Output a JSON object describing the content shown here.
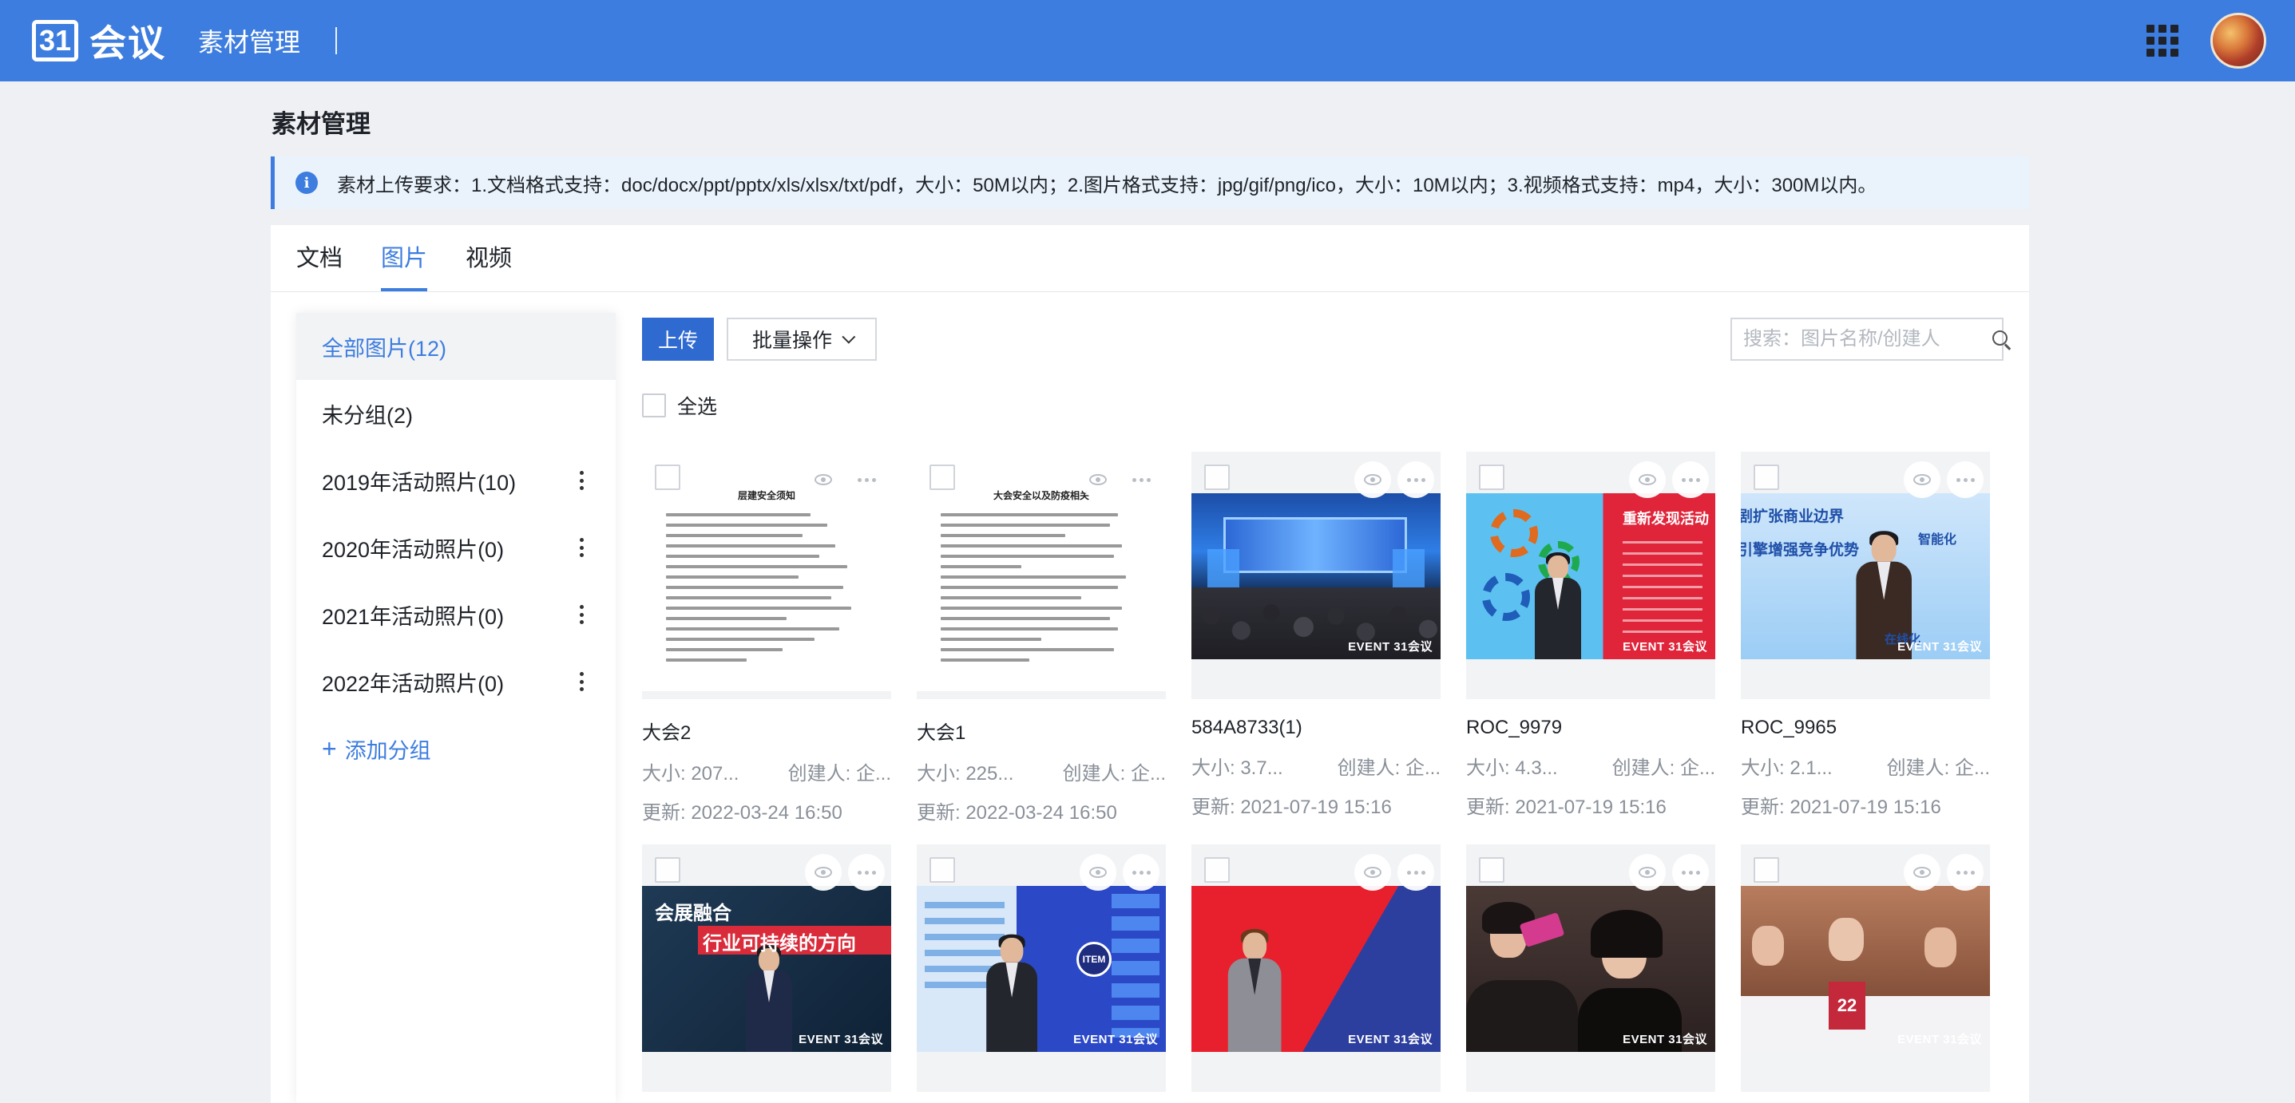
{
  "header": {
    "logo_mark": "31",
    "logo_text": "会议",
    "app_title": "素材管理",
    "apps_icon": "grid-apps-icon",
    "avatar_icon": "user-avatar"
  },
  "page": {
    "title": "素材管理",
    "notice": "素材上传要求：1.文档格式支持：doc/docx/ppt/pptx/xls/xlsx/txt/pdf，大小：50M以内；2.图片格式支持：jpg/gif/png/ico，大小：10M以内；3.视频格式支持：mp4，大小：300M以内。",
    "info_icon": "i"
  },
  "tabs": [
    {
      "label": "文档",
      "active": false
    },
    {
      "label": "图片",
      "active": true
    },
    {
      "label": "视频",
      "active": false
    }
  ],
  "sidebar": {
    "groups": [
      {
        "label": "全部图片(12)",
        "active": true,
        "has_menu": false
      },
      {
        "label": "未分组(2)",
        "active": false,
        "has_menu": false
      },
      {
        "label": "2019年活动照片(10)",
        "active": false,
        "has_menu": true
      },
      {
        "label": "2020年活动照片(0)",
        "active": false,
        "has_menu": true
      },
      {
        "label": "2021年活动照片(0)",
        "active": false,
        "has_menu": true
      },
      {
        "label": "2022年活动照片(0)",
        "active": false,
        "has_menu": true
      }
    ],
    "add_group_label": "添加分组",
    "add_group_icon": "+"
  },
  "toolbar": {
    "upload_label": "上传",
    "batch_label": "批量操作",
    "search_placeholder": "搜索：图片名称/创建人",
    "select_all_label": "全选"
  },
  "watermark": "EVENT 31会议",
  "cards": [
    {
      "name": "大会2",
      "size": "大小: 207...",
      "creator": "创建人: 企...",
      "updated": "更新: 2022-03-24 16:50",
      "kind": "doc",
      "doc_title": "层建安全须知"
    },
    {
      "name": "大会1",
      "size": "大小: 225...",
      "creator": "创建人: 企...",
      "updated": "更新: 2022-03-24 16:50",
      "kind": "doc",
      "doc_title": "大会安全以及防疫相关"
    },
    {
      "name": "584A8733(1)",
      "size": "大小: 3.7...",
      "creator": "创建人: 企...",
      "updated": "更新: 2021-07-19 15:16",
      "kind": "stage"
    },
    {
      "name": "ROC_9979",
      "size": "大小: 4.3...",
      "creator": "创建人: 企...",
      "updated": "更新: 2021-07-19 15:16",
      "kind": "speaker-red",
      "slogan": "重新发现活动"
    },
    {
      "name": "ROC_9965",
      "size": "大小: 2.1...",
      "creator": "创建人: 企...",
      "updated": "更新: 2021-07-19 15:16",
      "kind": "speaker-blue",
      "slogan": "剧扩张商业边界",
      "slogan2": "引擎增强竞争优势",
      "slogan3": "智能化",
      "slogan4": "在线化"
    },
    {
      "name": "",
      "size": "",
      "creator": "",
      "updated": "",
      "kind": "speaker-dark",
      "slogan": "会展融合",
      "slogan2": "行业可持续的方向"
    },
    {
      "name": "",
      "size": "",
      "creator": "",
      "updated": "",
      "kind": "speaker-screen",
      "slogan": "ITEM"
    },
    {
      "name": "",
      "size": "",
      "creator": "",
      "updated": "",
      "kind": "speaker-woman"
    },
    {
      "name": "",
      "size": "",
      "creator": "",
      "updated": "",
      "kind": "audience-phone"
    },
    {
      "name": "",
      "size": "",
      "creator": "",
      "updated": "",
      "kind": "audience-table",
      "slogan": "22"
    }
  ]
}
